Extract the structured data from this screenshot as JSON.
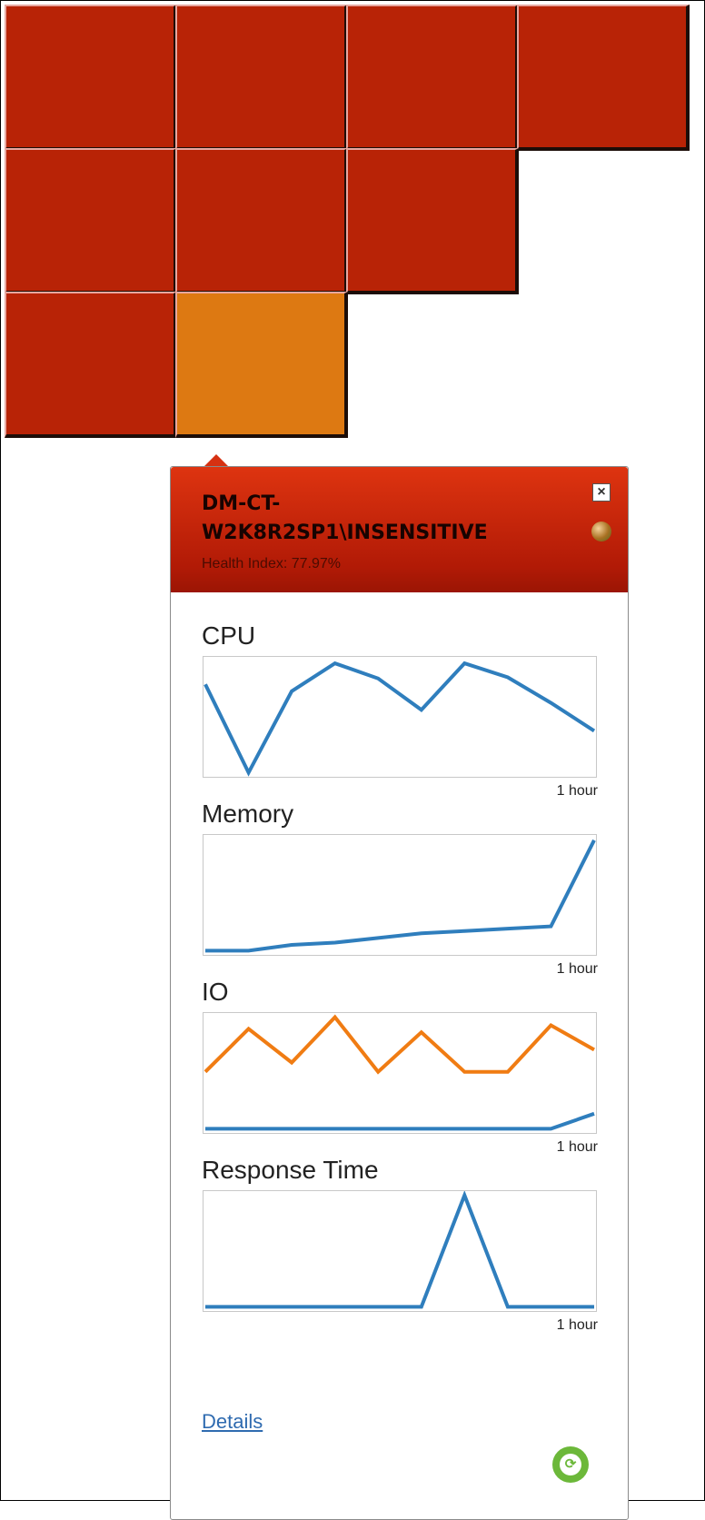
{
  "tiles": [
    {
      "row": 0,
      "col": 0,
      "color": "#b82306"
    },
    {
      "row": 0,
      "col": 1,
      "color": "#b82306"
    },
    {
      "row": 0,
      "col": 2,
      "color": "#b82306"
    },
    {
      "row": 0,
      "col": 3,
      "color": "#b82306"
    },
    {
      "row": 1,
      "col": 0,
      "color": "#b82306"
    },
    {
      "row": 1,
      "col": 1,
      "color": "#b82306"
    },
    {
      "row": 1,
      "col": 2,
      "color": "#b82306"
    },
    {
      "row": 2,
      "col": 0,
      "color": "#b82306"
    },
    {
      "row": 2,
      "col": 1,
      "color": "#dd7912",
      "selected": true
    }
  ],
  "popup": {
    "title": "DM-CT-W2K8R2SP1\\INSENSITIVE",
    "health": "Health Index: 77.97%",
    "close_icon": "close-icon",
    "status_icon": "status-orb-icon",
    "details_label": "Details",
    "refresh_icon": "refresh-icon"
  },
  "chart_data": [
    {
      "type": "line",
      "title": "CPU",
      "time_range_label": "1 hour",
      "ylim": [
        0,
        100
      ],
      "series": [
        {
          "color": "#2f7ebd",
          "values": [
            78,
            2,
            72,
            96,
            83,
            56,
            96,
            84,
            62,
            38
          ]
        }
      ]
    },
    {
      "type": "line",
      "title": "Memory",
      "time_range_label": "1 hour",
      "ylim": [
        0,
        100
      ],
      "series": [
        {
          "color": "#2f7ebd",
          "values": [
            2,
            2,
            7,
            9,
            13,
            17,
            19,
            21,
            23,
            97
          ]
        }
      ]
    },
    {
      "type": "line",
      "title": "IO",
      "time_range_label": "1 hour",
      "ylim": [
        0,
        100
      ],
      "series": [
        {
          "color": "#f07c13",
          "values": [
            51,
            88,
            59,
            98,
            51,
            85,
            51,
            51,
            91,
            70
          ]
        },
        {
          "color": "#2f7ebd",
          "values": [
            2,
            2,
            2,
            2,
            2,
            2,
            2,
            2,
            2,
            15
          ]
        }
      ]
    },
    {
      "type": "line",
      "title": "Response Time",
      "time_range_label": "1 hour",
      "ylim": [
        0,
        100
      ],
      "series": [
        {
          "color": "#2f7ebd",
          "values": [
            2,
            2,
            2,
            2,
            2,
            2,
            98,
            2,
            2,
            2
          ]
        }
      ]
    }
  ]
}
